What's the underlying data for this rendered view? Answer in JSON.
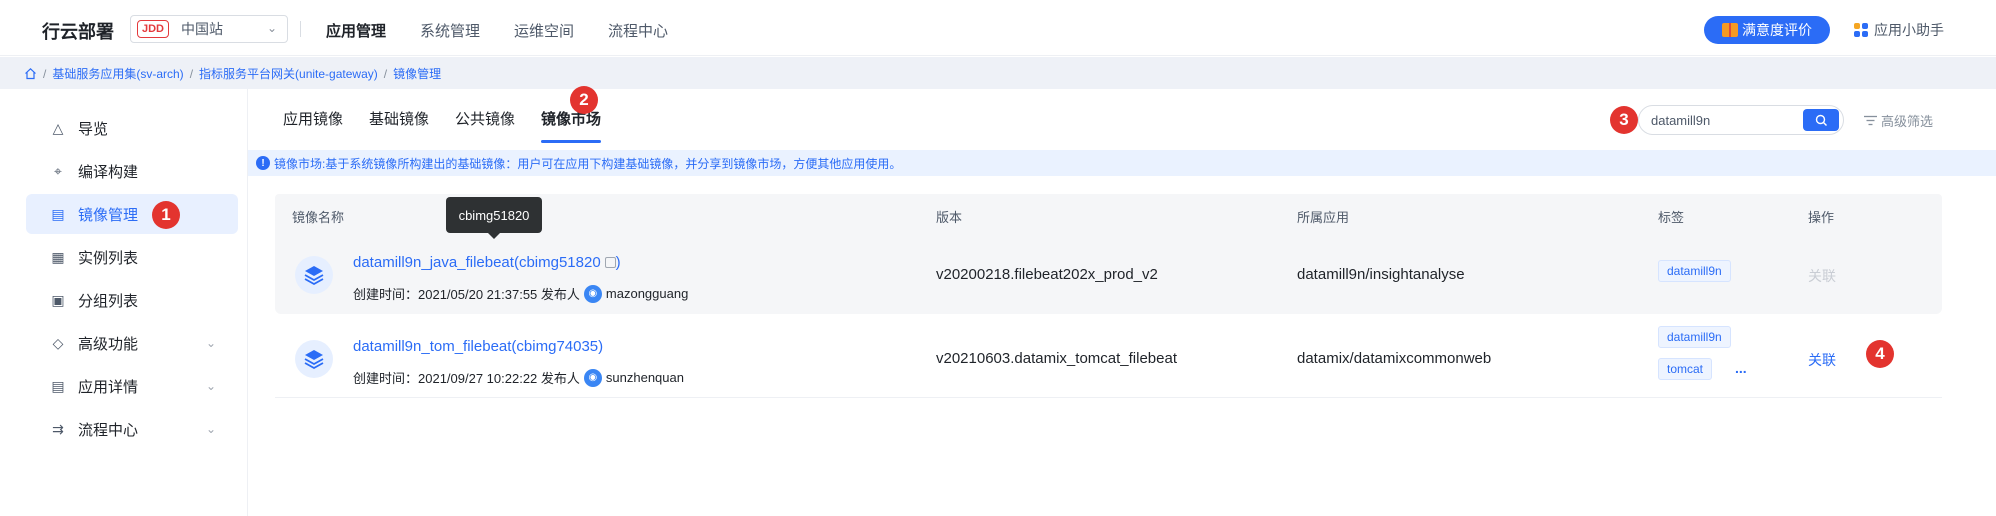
{
  "header": {
    "brand": "行云部署",
    "site_badge": "JDD",
    "site_name": "中国站",
    "nav": [
      "应用管理",
      "系统管理",
      "运维空间",
      "流程中心"
    ],
    "active_nav": "应用管理",
    "rating_label": "满意度评价",
    "assistant_label": "应用小助手"
  },
  "breadcrumb": {
    "items": [
      "基础服务应用集(sv-arch)",
      "指标服务平台网关(unite-gateway)",
      "镜像管理"
    ],
    "separator": "/"
  },
  "sidebar": {
    "items": [
      {
        "label": "导览",
        "icon": "compass-icon",
        "expandable": false
      },
      {
        "label": "编译构建",
        "icon": "build-icon",
        "expandable": false
      },
      {
        "label": "镜像管理",
        "icon": "clipboard-icon",
        "expandable": false,
        "active": true
      },
      {
        "label": "实例列表",
        "icon": "grid-icon",
        "expandable": false
      },
      {
        "label": "分组列表",
        "icon": "folder-icon",
        "expandable": false
      },
      {
        "label": "高级功能",
        "icon": "diamond-icon",
        "expandable": true
      },
      {
        "label": "应用详情",
        "icon": "layout-icon",
        "expandable": true
      },
      {
        "label": "流程中心",
        "icon": "flow-icon",
        "expandable": true
      }
    ]
  },
  "tabs": {
    "items": [
      "应用镜像",
      "基础镜像",
      "公共镜像",
      "镜像市场"
    ],
    "active": "镜像市场"
  },
  "search": {
    "value": "datamill9n",
    "filter_label": "高级筛选"
  },
  "notice": "镜像市场:基于系统镜像所构建出的基础镜像：用户可在应用下构建基础镜像，并分享到镜像市场，方便其他应用使用。",
  "table": {
    "columns": [
      "镜像名称",
      "版本",
      "所属应用",
      "标签",
      "操作"
    ],
    "rows": [
      {
        "name": "datamill9n_java_filebeat(cbimg51820",
        "name_suffix": ")",
        "created_prefix": "创建时间：2021/05/20 21:37:55 发布人",
        "publisher": "mazongguang",
        "version": "v20200218.filebeat202x_prod_v2",
        "app": "datamill9n/insightanalyse",
        "tags": [
          "datamill9n"
        ],
        "action": "关联",
        "action_enabled": false
      },
      {
        "name": "datamill9n_tom_filebeat(cbimg74035)",
        "name_suffix": "",
        "created_prefix": "创建时间：2021/09/27 10:22:22 发布人",
        "publisher": "sunzhenquan",
        "version": "v20210603.datamix_tomcat_filebeat",
        "app": "datamix/datamixcommonweb",
        "tags": [
          "datamill9n",
          "tomcat"
        ],
        "more": "...",
        "action": "关联",
        "action_enabled": true
      }
    ]
  },
  "tooltip": "cbimg51820",
  "annotations": [
    "1",
    "2",
    "3",
    "4"
  ],
  "colors": {
    "accent": "#2b6cf6",
    "badge": "#e3342f",
    "disabled": "#c9cdd4"
  }
}
